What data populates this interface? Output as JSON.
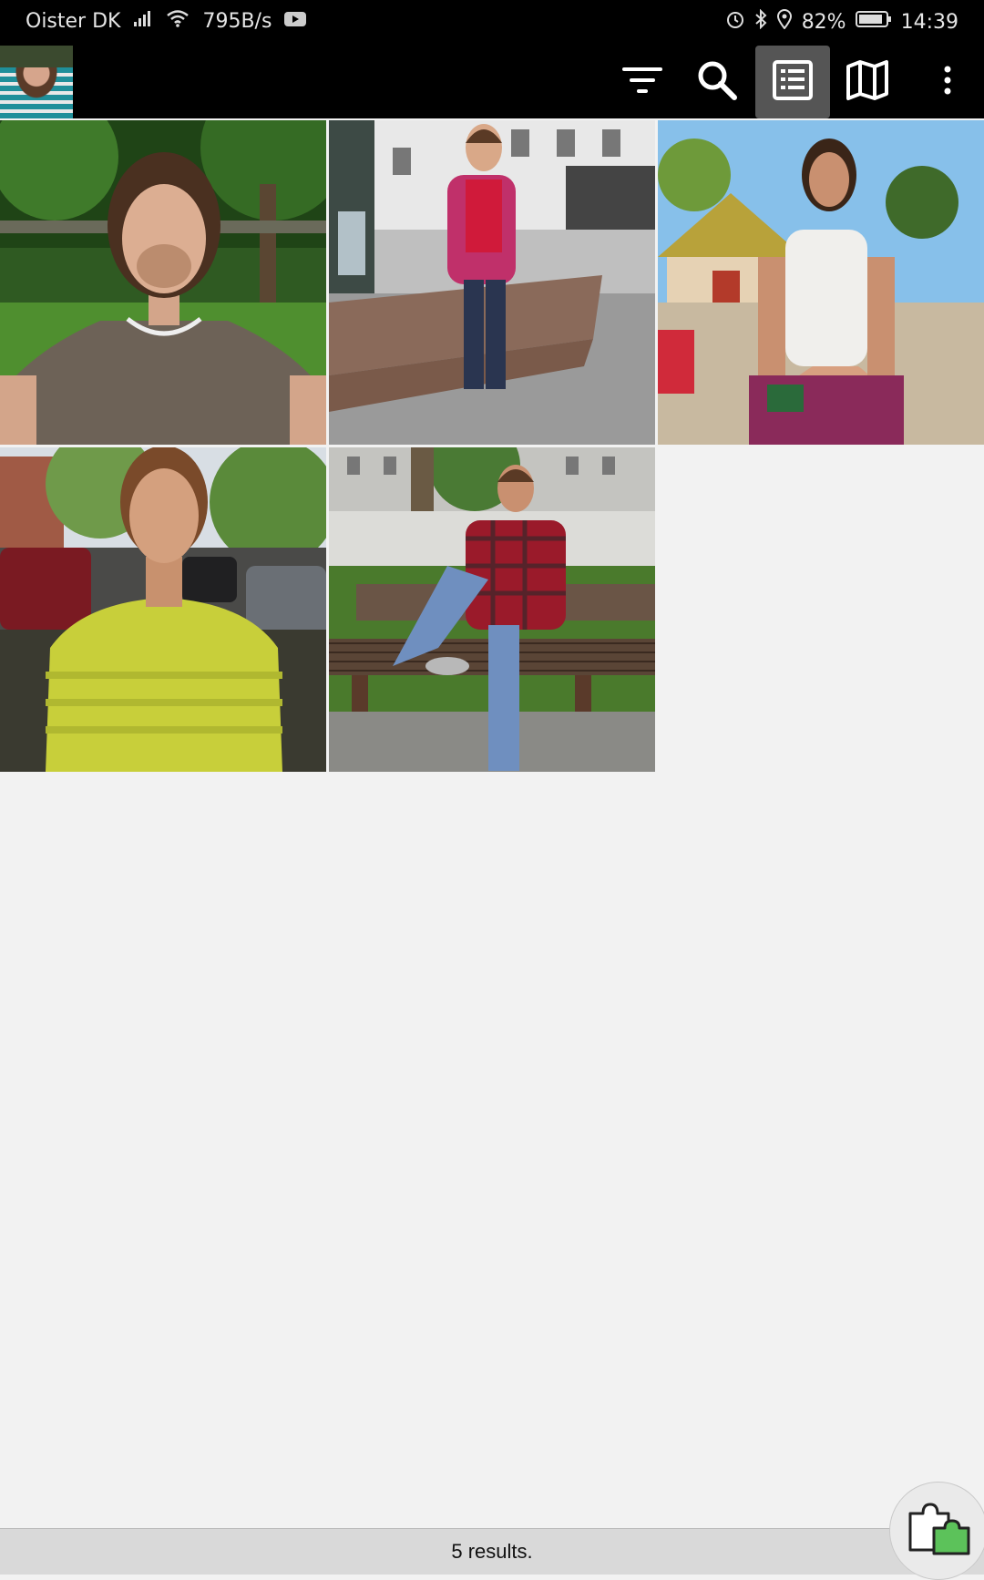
{
  "status_bar": {
    "carrier": "Oister DK",
    "net_speed": "795B/s",
    "battery": "82%",
    "time": "14:39"
  },
  "toolbar": {
    "buttons": [
      {
        "name": "filter-icon",
        "active": false
      },
      {
        "name": "search-icon",
        "active": false
      },
      {
        "name": "list-view-icon",
        "active": true
      },
      {
        "name": "map-icon",
        "active": false
      },
      {
        "name": "more-options-icon",
        "active": false
      }
    ]
  },
  "gallery": {
    "photos": [
      {
        "scene": "park selfie, grey t-shirt"
      },
      {
        "scene": "fountain, pink jacket"
      },
      {
        "scene": "beach, white tank top"
      },
      {
        "scene": "street, yellow t-shirt"
      },
      {
        "scene": "bench, plaid shirt"
      }
    ]
  },
  "footer": {
    "results_text": "5 results."
  },
  "colors": {
    "background": "#f2f2f2",
    "toolbar": "#000000",
    "active_button": "#555555",
    "fab_accent": "#4caf50"
  }
}
